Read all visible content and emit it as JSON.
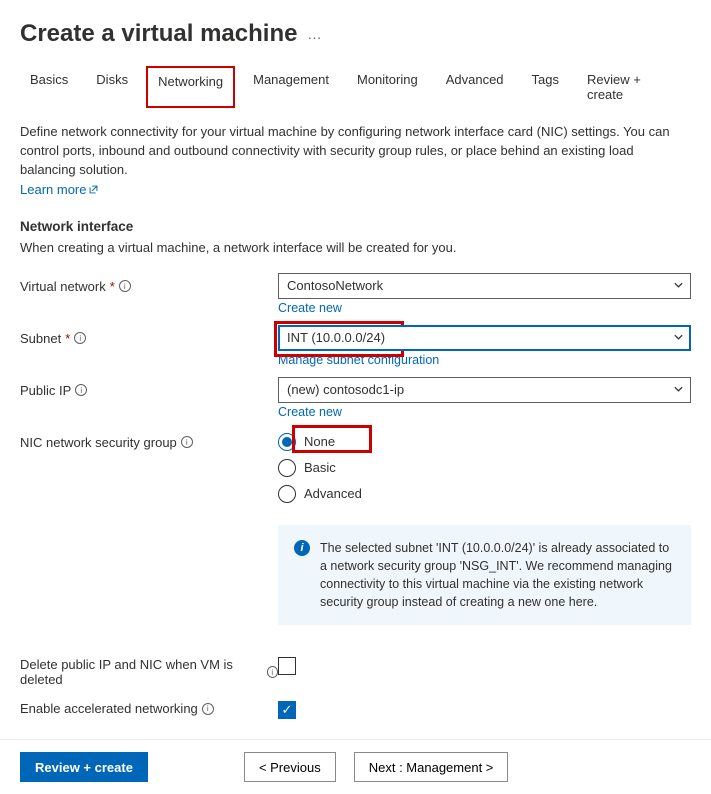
{
  "header": {
    "title": "Create a virtual machine",
    "more_label": "···"
  },
  "tabs": [
    "Basics",
    "Disks",
    "Networking",
    "Management",
    "Monitoring",
    "Advanced",
    "Tags",
    "Review + create"
  ],
  "description": "Define network connectivity for your virtual machine by configuring network interface card (NIC) settings. You can control ports, inbound and outbound connectivity with security group rules, or place behind an existing load balancing solution.",
  "learn_more": "Learn more",
  "section": {
    "title": "Network interface",
    "sub": "When creating a virtual machine, a network interface will be created for you."
  },
  "fields": {
    "vnet": {
      "label": "Virtual network",
      "value": "ContosoNetwork",
      "create": "Create new"
    },
    "subnet": {
      "label": "Subnet",
      "value": "INT (10.0.0.0/24)",
      "manage": "Manage subnet configuration"
    },
    "publicip": {
      "label": "Public IP",
      "value": "(new) contosodc1-ip",
      "create": "Create new"
    },
    "nsg": {
      "label": "NIC network security group",
      "options": {
        "none": "None",
        "basic": "Basic",
        "advanced": "Advanced"
      }
    },
    "delete": {
      "label": "Delete public IP and NIC when VM is deleted"
    },
    "accel": {
      "label": "Enable accelerated networking"
    }
  },
  "infobox": "The selected subnet 'INT (10.0.0.0/24)' is already associated to a network security group 'NSG_INT'. We recommend managing connectivity to this virtual machine via the existing network security group instead of creating a new one here.",
  "footer": {
    "review": "Review + create",
    "prev": "< Previous",
    "next": "Next : Management >"
  }
}
